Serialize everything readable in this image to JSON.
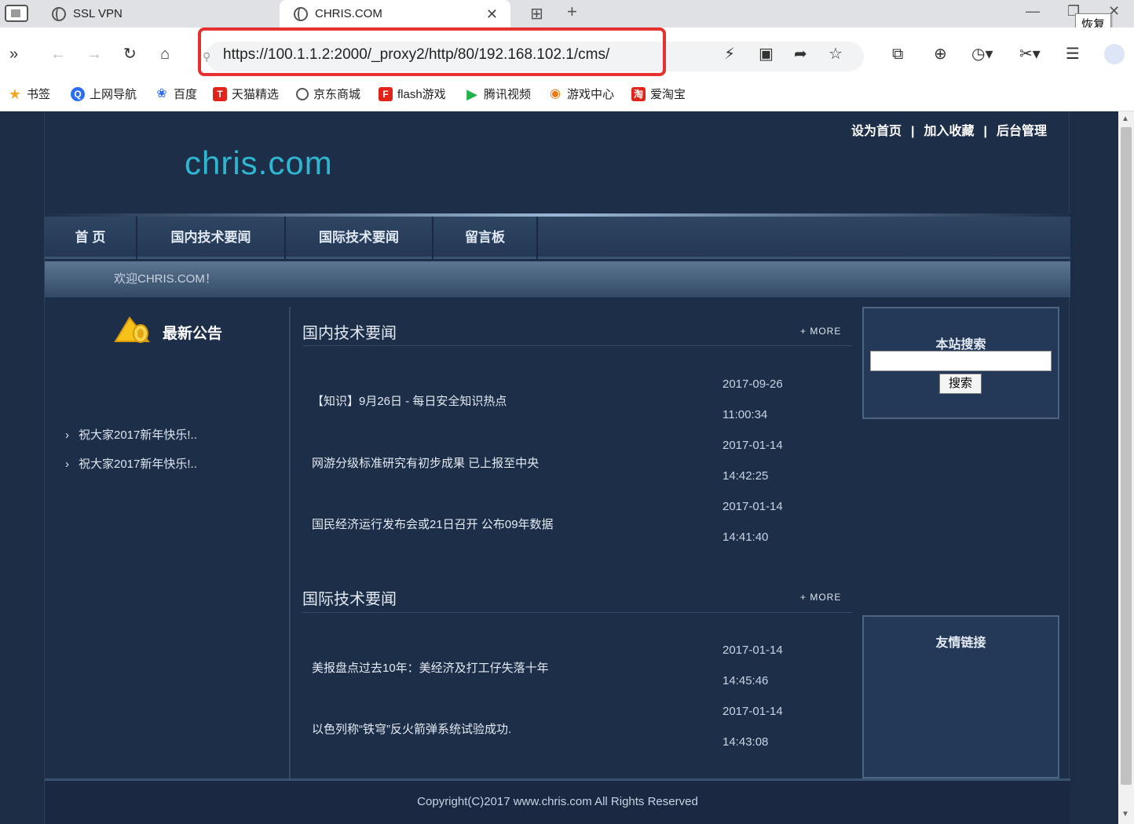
{
  "browser": {
    "tabs": [
      {
        "label": "SSL VPN"
      },
      {
        "label": "CHRIS.COM"
      }
    ],
    "tooltip": "恢复",
    "url": "https://100.1.1.2:2000/_proxy2/http/80/192.168.102.1/cms/",
    "bookmarks": [
      "书签",
      "上网导航",
      "百度",
      "天猫精选",
      "京东商城",
      "flash游戏",
      "腾讯视频",
      "游戏中心",
      "爱淘宝"
    ]
  },
  "site": {
    "toplinks": [
      "设为首页",
      "加入收藏",
      "后台管理"
    ],
    "separator": "|",
    "logo": "chris.com",
    "nav": [
      "首 页",
      "国内技术要闻",
      "国际技术要闻",
      "留言板"
    ],
    "welcome": "欢迎CHRIS.COM！",
    "notice": {
      "title": "最新公告",
      "items": [
        "祝大家2017新年快乐!..",
        "祝大家2017新年快乐!.."
      ]
    },
    "more": "+ MORE",
    "domestic": {
      "title": "国内技术要闻",
      "items": [
        {
          "title": "【知识】9月26日 - 每日安全知识热点",
          "date": "2017-09-26",
          "time": "11:00:34"
        },
        {
          "title": "网游分级标准研究有初步成果 已上报至中央",
          "date": "2017-01-14",
          "time": "14:42:25"
        },
        {
          "title": "国民经济运行发布会或21日召开 公布09年数据",
          "date": "2017-01-14",
          "time": "14:41:40"
        }
      ]
    },
    "international": {
      "title": "国际技术要闻",
      "items": [
        {
          "title": "美报盘点过去10年：美经济及打工仔失落十年",
          "date": "2017-01-14",
          "time": "14:45:46"
        },
        {
          "title": "以色列称“铁穹”反火箭弹系统试验成功.",
          "date": "2017-01-14",
          "time": "14:43:08"
        }
      ]
    },
    "search": {
      "title": "本站搜索",
      "button": "搜索"
    },
    "links": {
      "title": "友情链接"
    },
    "footer": "Copyright(C)2017 www.chris.com All Rights Reserved"
  }
}
